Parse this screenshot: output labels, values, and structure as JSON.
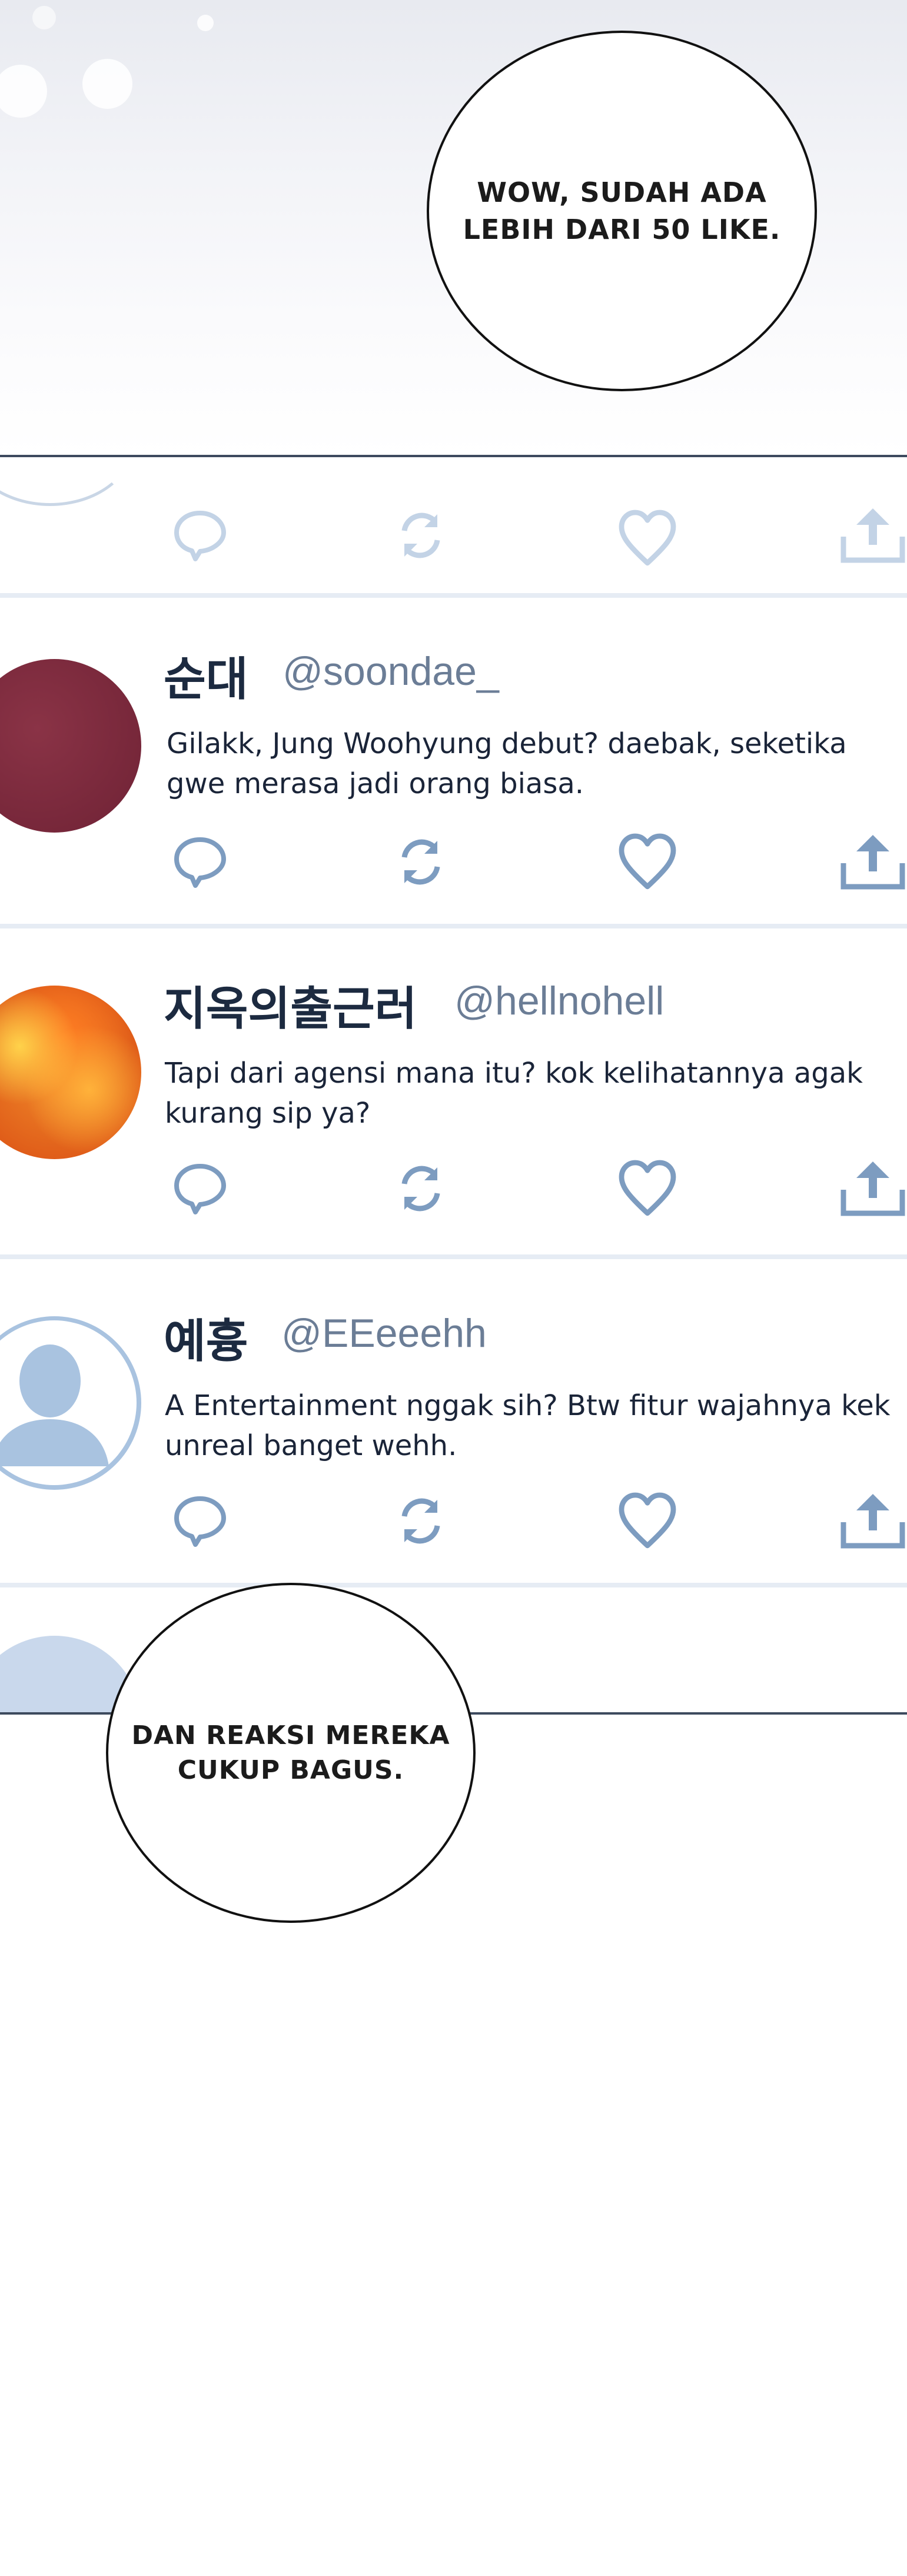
{
  "bubbles": {
    "top": "WOW, SUDAH ADA\nLEBIH DARI 50 LIKE.",
    "bottom": "DAN REAKSI MEREKA\nCUKUP BAGUS."
  },
  "colors": {
    "icon_active": "#7d9cc0",
    "icon_faded": "#c3d3e6",
    "divider": "#3d4a5e",
    "name": "#1c2a40",
    "handle": "#6b7d96"
  },
  "posts": [
    {
      "name": "순대",
      "handle": "@soondae_",
      "text": "Gilakk, Jung Woohyung debut? daebak, seketika\ngwe merasa jadi orang biasa.",
      "avatar": "maroon-avatar"
    },
    {
      "name": "지옥의출근러",
      "handle": "@hellnohell",
      "text": "Tapi dari agensi mana itu? kok kelihatannya agak\nkurang sip ya?",
      "avatar": "fire-avatar"
    },
    {
      "name": "예흉",
      "handle": "@EEeeehh",
      "text": "A Entertainment nggak sih? Btw fitur wajahnya kek\nunreal banget wehh.",
      "avatar": "default-user-avatar"
    }
  ],
  "action_icons": [
    "reply-icon",
    "retweet-icon",
    "like-icon",
    "share-icon"
  ]
}
